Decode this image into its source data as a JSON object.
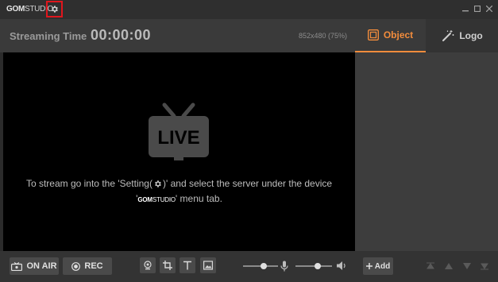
{
  "titlebar": {
    "logo_gom": "GOM",
    "logo_studio": "STUDIO",
    "min": "–",
    "max": "☐",
    "close": "✕"
  },
  "header": {
    "streaming_label": "Streaming Time",
    "streaming_time": "00:00:00",
    "resolution": "852x480 (75%)"
  },
  "preview": {
    "live_text": "LIVE",
    "line1_a": "To stream go into the 'Setting(",
    "line1_b": ")' and select the server under the device",
    "line2_a": "'",
    "line2_logo_gom": "GOM",
    "line2_logo_studio": "STUDIO",
    "line2_b": "' menu tab."
  },
  "bottom": {
    "on_air_label": "ON AIR",
    "rec_label": "REC"
  },
  "right_panel": {
    "tab_object": "Object",
    "tab_logo": "Logo",
    "add_label": "Add"
  },
  "colors": {
    "accent": "#f28c3c",
    "highlight_box": "#e0161d"
  }
}
